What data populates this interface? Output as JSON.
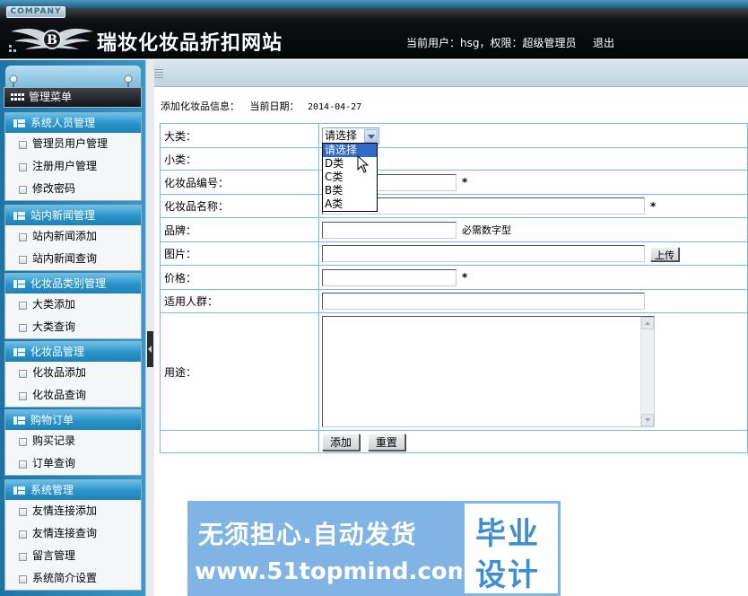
{
  "header": {
    "company": "COMPANY",
    "site_title": "瑞妆化妆品折扣网站",
    "user_info": "当前用户：hsg，权限：超级管理员",
    "logout": "退出"
  },
  "sidebar": {
    "menu_title": "管理菜单",
    "groups": [
      {
        "title": "系统人员管理",
        "items": [
          "管理员用户管理",
          "注册用户管理",
          "修改密码"
        ]
      },
      {
        "title": "站内新闻管理",
        "items": [
          "站内新闻添加",
          "站内新闻查询"
        ]
      },
      {
        "title": "化妆品类别管理",
        "items": [
          "大类添加",
          "大类查询"
        ]
      },
      {
        "title": "化妆品管理",
        "items": [
          "化妆品添加",
          "化妆品查询"
        ]
      },
      {
        "title": "购物订单",
        "items": [
          "购买记录",
          "订单查询"
        ]
      },
      {
        "title": "系统管理",
        "items": [
          "友情连接添加",
          "友情连接查询",
          "留言管理",
          "系统简介设置"
        ]
      }
    ]
  },
  "content": {
    "heading": "添加化妆品信息：",
    "date_label": "当前日期：",
    "date_value": "2014-04-27"
  },
  "form": {
    "category_label": "大类：",
    "category_selected": "请选择",
    "category_options": [
      "请选择",
      "D类",
      "C类",
      "B类",
      "A类"
    ],
    "subcategory_label": "小类：",
    "code_label": "化妆品编号：",
    "name_label": "化妆品名称：",
    "brand_label": "品牌：",
    "brand_hint": "必需数字型",
    "image_label": "图片：",
    "upload_button": "上传",
    "price_label": "价格：",
    "audience_label": "适用人群：",
    "usage_label": "用途：",
    "required_mark": "*",
    "submit_button": "添加",
    "reset_button": "重置"
  },
  "watermark": {
    "line1": "无须担心.自动发货",
    "line2": "www.51topmind.com",
    "right1": "毕业",
    "right2": "设计"
  },
  "colors": {
    "header_bg": "#0d0f12",
    "sidebar_bg": "#2a88b8",
    "group_head": "#2a93c9",
    "table_border": "#6fbfe0",
    "select_highlight": "#316ac5",
    "watermark_blue": "#7fb4e4"
  }
}
